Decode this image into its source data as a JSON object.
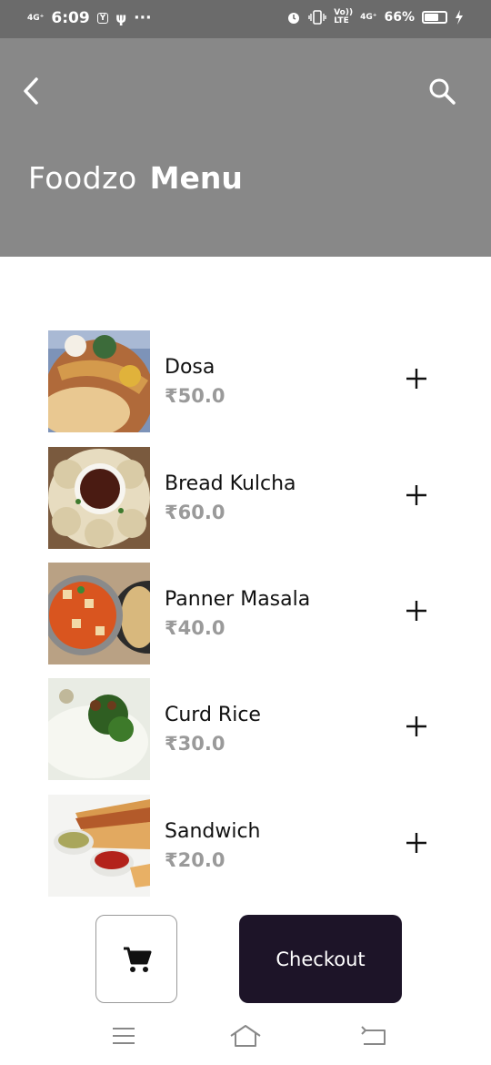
{
  "status_bar": {
    "time": "6:09",
    "network_left": "4G⁺",
    "more": "···",
    "network_right": "4G⁺",
    "volte_top": "Vo))",
    "volte_bottom": "LTE",
    "battery_percent": "66%",
    "battery_level": 0.66
  },
  "header": {
    "brand": "Foodzo",
    "title": "Menu"
  },
  "menu": {
    "items": [
      {
        "name": "Dosa",
        "price": "₹50.0"
      },
      {
        "name": "Bread Kulcha",
        "price": "₹60.0"
      },
      {
        "name": "Panner Masala",
        "price": "₹40.0"
      },
      {
        "name": "Curd Rice",
        "price": "₹30.0"
      },
      {
        "name": "Sandwich",
        "price": "₹20.0"
      }
    ]
  },
  "actions": {
    "checkout_label": "Checkout"
  },
  "colors": {
    "header_bg": "#888888",
    "status_bg": "#6b6b6b",
    "checkout_bg": "#1d1428",
    "price": "#9a9a9a"
  }
}
